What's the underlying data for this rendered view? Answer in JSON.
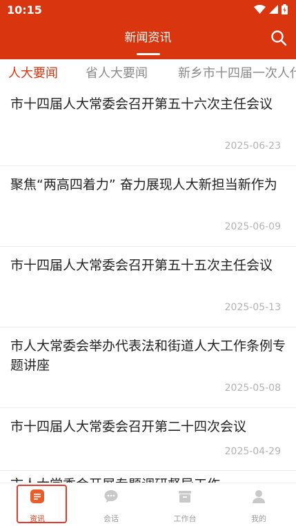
{
  "status": {
    "time": "10:15"
  },
  "header": {
    "title": "新闻资讯"
  },
  "tabs": [
    {
      "label": "人大要闻",
      "active": true
    },
    {
      "label": "省人大要闻",
      "active": false
    },
    {
      "label": "新乡市十四届一次人代会",
      "active": false
    }
  ],
  "news": [
    {
      "title": "市十四届人大常委会召开第五十六次主任会议",
      "date": "2025-06-23"
    },
    {
      "title": "聚焦“两高四着力” 奋力展现人大新担当新作为",
      "date": "2025-06-09"
    },
    {
      "title": "市十四届人大常委会召开第五十五次主任会议",
      "date": "2025-05-13"
    },
    {
      "title": "市人大常委会举办代表法和街道人大工作条例专题讲座",
      "date": "2025-05-08"
    },
    {
      "title": "市十四届人大常委会召开第二十四次会议",
      "date": "2025-04-29"
    },
    {
      "title": "市人大常委会开展专题调研督导工作",
      "date": ""
    }
  ],
  "bottom_nav": [
    {
      "label": "资讯",
      "icon": "news-icon",
      "active": true
    },
    {
      "label": "会话",
      "icon": "chat-icon",
      "active": false
    },
    {
      "label": "工作台",
      "icon": "workbench-icon",
      "active": false
    },
    {
      "label": "我的",
      "icon": "user-icon",
      "active": false
    }
  ],
  "colors": {
    "brand": "#d9360f",
    "inactive": "#9a9a9a",
    "date": "#b3b3b3"
  }
}
